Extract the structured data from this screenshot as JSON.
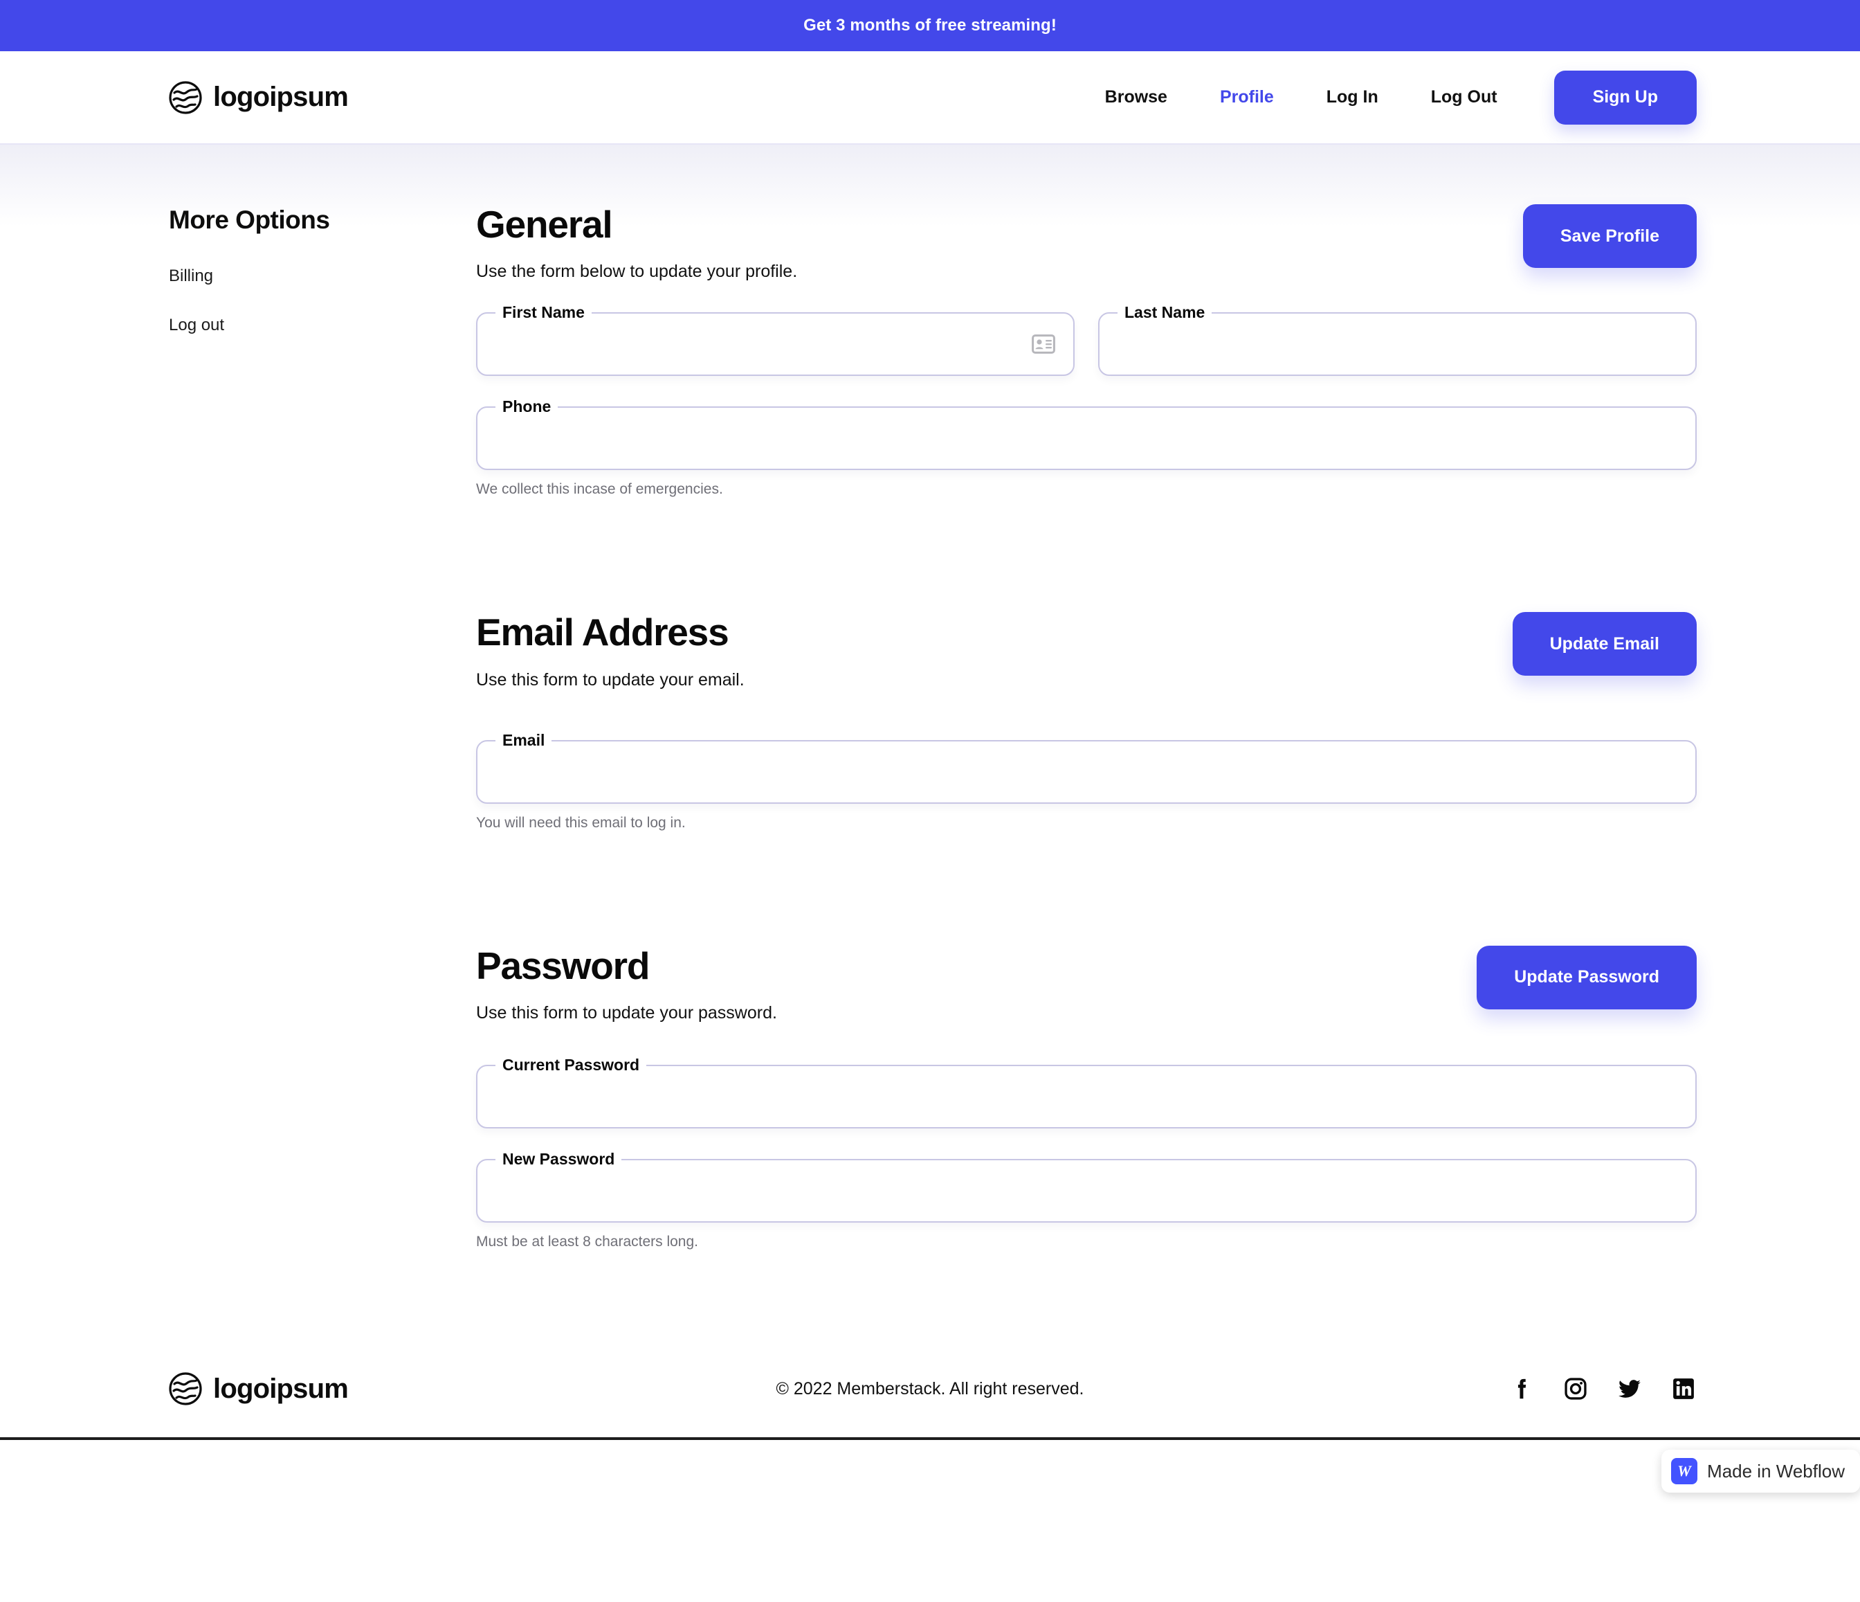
{
  "promo": {
    "text": "Get 3 months of free streaming!",
    "background": "#4348ea"
  },
  "brand": {
    "name": "logoipsum",
    "icon": "logoipsum-globe-icon"
  },
  "nav": {
    "links": [
      {
        "label": "Browse",
        "active": false
      },
      {
        "label": "Profile",
        "active": true
      },
      {
        "label": "Log In",
        "active": false
      },
      {
        "label": "Log Out",
        "active": false
      }
    ],
    "signup_label": "Sign Up",
    "accent_color": "#4348ea"
  },
  "sidebar": {
    "title": "More Options",
    "items": [
      {
        "label": "Billing"
      },
      {
        "label": "Log out"
      }
    ]
  },
  "sections": {
    "general": {
      "heading": "General",
      "subtitle": "Use the form below to update your profile.",
      "button_label": "Save Profile",
      "fields": {
        "first_name": {
          "label": "First Name",
          "value": "",
          "placeholder": ""
        },
        "last_name": {
          "label": "Last Name",
          "value": "",
          "placeholder": ""
        },
        "phone": {
          "label": "Phone",
          "value": "",
          "placeholder": "",
          "help": "We collect this incase of emergencies."
        }
      }
    },
    "email": {
      "heading": "Email Address",
      "subtitle": "Use this form to update your email.",
      "button_label": "Update Email",
      "fields": {
        "email": {
          "label": "Email",
          "value": "",
          "placeholder": "",
          "help": "You will need this email to log in."
        }
      }
    },
    "password": {
      "heading": "Password",
      "subtitle": "Use this form to update your password.",
      "button_label": "Update Password",
      "fields": {
        "current_password": {
          "label": "Current Password",
          "value": "",
          "placeholder": ""
        },
        "new_password": {
          "label": "New Password",
          "value": "",
          "placeholder": "",
          "help": "Must be at least 8 characters long."
        }
      }
    }
  },
  "footer": {
    "brand_name": "logoipsum",
    "copyright": "© 2022 Memberstack. All right reserved.",
    "socials": [
      {
        "name": "facebook-icon"
      },
      {
        "name": "instagram-icon"
      },
      {
        "name": "twitter-icon"
      },
      {
        "name": "linkedin-icon"
      }
    ]
  },
  "webflow_badge": {
    "label": "Made in Webflow",
    "mark": "W",
    "color": "#4353ff"
  }
}
